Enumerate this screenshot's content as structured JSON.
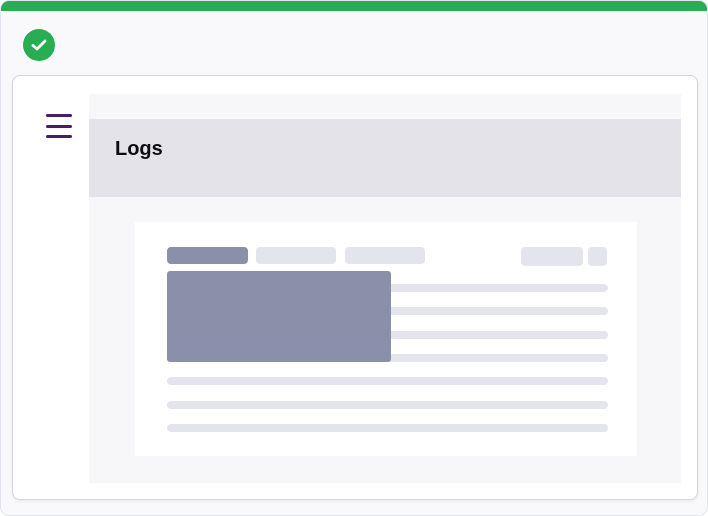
{
  "status": {
    "icon": "check-circle-icon",
    "color": "#27ae53"
  },
  "menu": {
    "icon": "hamburger-menu-icon",
    "color": "#4a1a6b"
  },
  "panel": {
    "title": "Logs"
  },
  "skeleton": {
    "tabs": [
      "tab-placeholder-1",
      "tab-placeholder-2",
      "tab-placeholder-3"
    ],
    "actions": [
      "action-placeholder-1",
      "action-placeholder-2"
    ],
    "lines": 7
  }
}
